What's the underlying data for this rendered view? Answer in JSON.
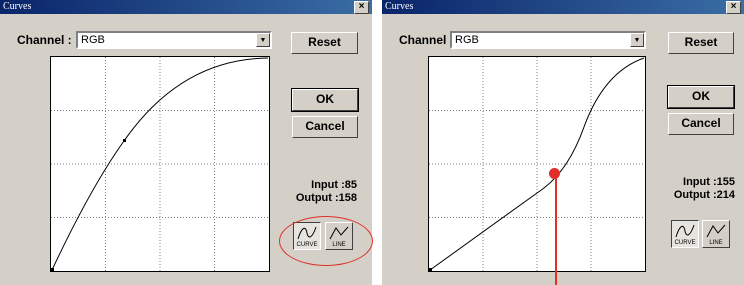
{
  "left_dialog": {
    "title": "Curves",
    "close": "×",
    "channel_label": "Channel :",
    "channel_value": "RGB",
    "reset": "Reset",
    "ok": "OK",
    "cancel": "Cancel",
    "input_label": "Input :",
    "input_value": "85",
    "output_label": "Output :",
    "output_value": "158",
    "curve_label": "CURVE",
    "line_label": "LINE"
  },
  "right_dialog": {
    "title": "Curves",
    "close": "×",
    "channel_label": "Channel :",
    "channel_value": "RGB",
    "reset": "Reset",
    "ok": "OK",
    "cancel": "Cancel",
    "input_label": "Input :",
    "input_value": "155",
    "output_label": "Output :",
    "output_value": "214",
    "curve_label": "CURVE",
    "line_label": "LINE"
  },
  "colors": {
    "annotation": "#e0302a",
    "titlebar": "#0a246a",
    "face": "#d4d0c8"
  }
}
